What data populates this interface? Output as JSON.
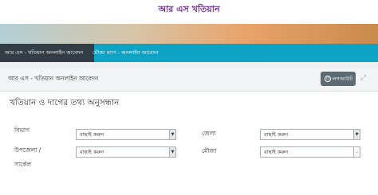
{
  "header": {
    "site_title": "আর এস খতিয়ান"
  },
  "tabs": [
    {
      "label": "আর এস - খতিয়ান অনলাইন আবেদন",
      "active": true
    },
    {
      "label": "মৌজা ম্যাপ - অনলাইন আবেদন",
      "active": false
    }
  ],
  "panel": {
    "title": "আর এস - খতিয়ান অনলাইন আবেদন",
    "logout_label": "লগআউট"
  },
  "form": {
    "section_title": "খতিয়ান ও দাগের তথ্য অনুসন্ধান",
    "division": {
      "label": "বিভাগ",
      "value": "বাছাই করুন"
    },
    "district": {
      "label": "জেলা",
      "value": "বাছাই করুন"
    },
    "upazila": {
      "label": "উপজেলা /",
      "label2": "সার্কেল",
      "value": "বাছাই করুন"
    },
    "mouza": {
      "label": "মৌজা",
      "value": "বাছাই করুন"
    }
  },
  "colors": {
    "tab_bar": "#0ea3c5",
    "tab_active": "#333d45",
    "title": "#6f2c91",
    "logout_button": "#5d6a72"
  }
}
